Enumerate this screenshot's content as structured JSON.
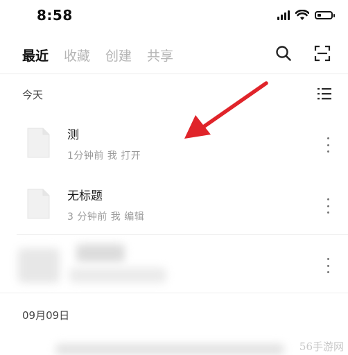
{
  "status_bar": {
    "time": "8:58",
    "icons": [
      "cellular-signal-icon",
      "wifi-icon",
      "battery-icon"
    ],
    "battery_level": 0.3
  },
  "tabs": [
    {
      "label": "最近",
      "active": true
    },
    {
      "label": "收藏",
      "active": false
    },
    {
      "label": "创建",
      "active": false
    },
    {
      "label": "共享",
      "active": false
    }
  ],
  "top_actions": [
    "search-icon",
    "scan-icon"
  ],
  "sections": {
    "today": "今天",
    "date2": "09月09日"
  },
  "files": [
    {
      "name": "测",
      "meta": "1分钟前 我 打开"
    },
    {
      "name": "无标题",
      "meta": "3 分钟前 我 编辑"
    }
  ],
  "watermark": "56手游网",
  "colors": {
    "accent_arrow": "#e0242a",
    "text_primary": "#111111",
    "text_secondary": "#9a9a9a",
    "tab_inactive": "#b5b5b5",
    "divider": "#eeeeee"
  }
}
